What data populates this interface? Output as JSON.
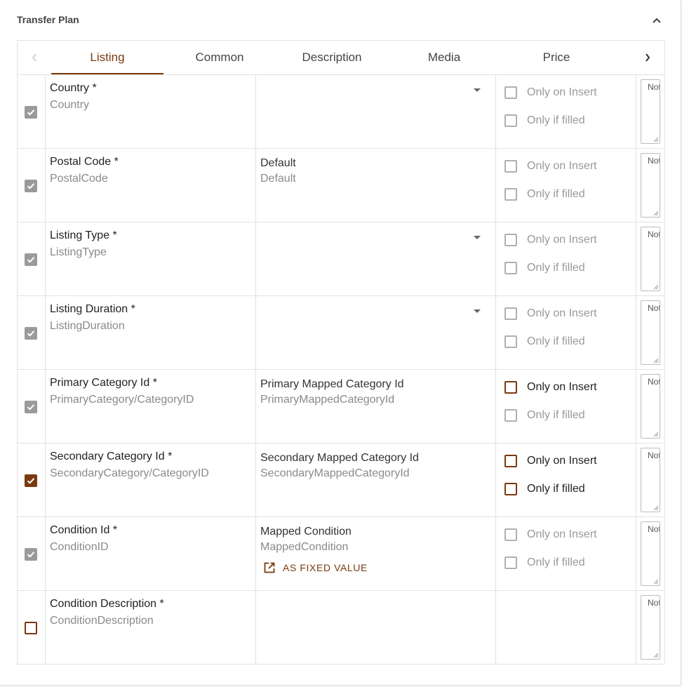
{
  "panel": {
    "title": "Transfer Plan"
  },
  "tabs": [
    {
      "label": "Listing",
      "active": true
    },
    {
      "label": "Common"
    },
    {
      "label": "Description"
    },
    {
      "label": "Media"
    },
    {
      "label": "Price"
    }
  ],
  "options": {
    "only_on_insert": "Only on Insert",
    "only_if_filled": "Only if filled"
  },
  "note_placeholder": "Note",
  "fixed_value_label": "AS FIXED VALUE",
  "rows": [
    {
      "label": "Country *",
      "path": "Country",
      "map_label": "",
      "map_path": "",
      "has_dropdown": true,
      "checkbox": "checked-gray",
      "opts_enabled": false
    },
    {
      "label": "Postal Code *",
      "path": "PostalCode",
      "map_label": "Default",
      "map_path": "Default",
      "has_dropdown": false,
      "checkbox": "checked-gray",
      "opts_enabled": false
    },
    {
      "label": "Listing Type *",
      "path": "ListingType",
      "map_label": "",
      "map_path": "",
      "has_dropdown": true,
      "checkbox": "checked-gray",
      "opts_enabled": false
    },
    {
      "label": "Listing Duration *",
      "path": "ListingDuration",
      "map_label": "",
      "map_path": "",
      "has_dropdown": true,
      "checkbox": "checked-gray",
      "opts_enabled": false
    },
    {
      "label": "Primary Category Id *",
      "path": "PrimaryCategory/CategoryID",
      "map_label": "Primary Mapped Category Id",
      "map_path": "PrimaryMappedCategoryId",
      "has_dropdown": false,
      "checkbox": "checked-gray",
      "opts_enabled": false,
      "insert_enabled": true
    },
    {
      "label": "Secondary Category Id *",
      "path": "SecondaryCategory/CategoryID",
      "map_label": "Secondary Mapped Category Id",
      "map_path": "SecondaryMappedCategoryId",
      "has_dropdown": false,
      "checkbox": "checked-brown",
      "opts_enabled": true
    },
    {
      "label": "Condition Id *",
      "path": "ConditionID",
      "map_label": "Mapped Condition",
      "map_path": "MappedCondition",
      "has_dropdown": false,
      "checkbox": "checked-gray",
      "opts_enabled": false,
      "fixed_value": true
    },
    {
      "label": "Condition Description *",
      "path": "ConditionDescription",
      "map_label": "",
      "map_path": "",
      "has_dropdown": false,
      "checkbox": "unchecked-brown",
      "opts_enabled": false,
      "no_opts": true
    }
  ],
  "colors": {
    "accent": "#7a3a0e",
    "disabled": "#9a9a9a",
    "border": "#e2e2e2"
  }
}
